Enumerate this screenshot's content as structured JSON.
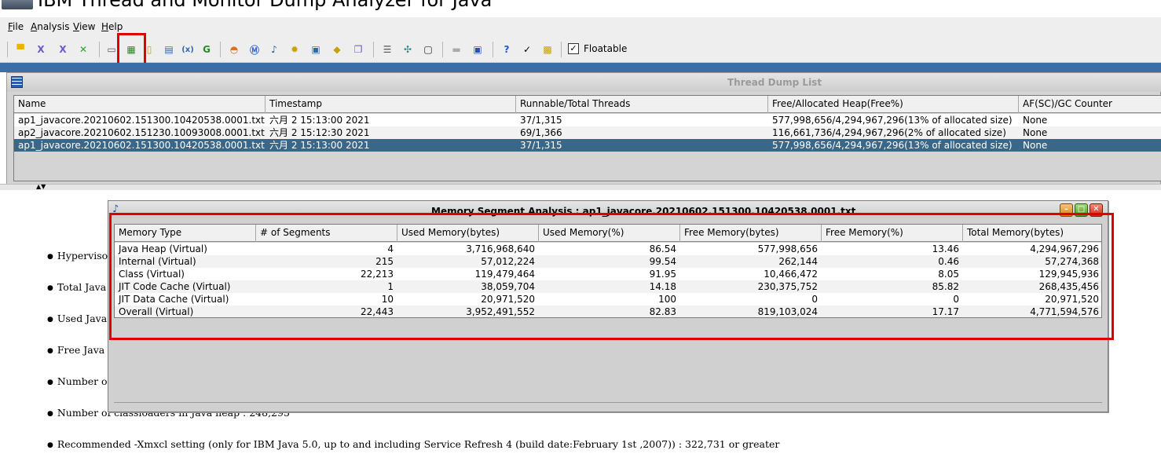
{
  "window": {
    "title": "IBM Thread and Monitor Dump Analyzer for Java"
  },
  "menu": [
    "File",
    "Analysis",
    "View",
    "Help"
  ],
  "toolbar": {
    "floatable_label": "Floatable",
    "floatable_checked": "✓",
    "icons": [
      "open-folder-icon",
      "close-icon",
      "close-all-icon",
      "clear-icon",
      "thread-dump-icon",
      "memory-segment-icon",
      "delete-icon",
      "compare-icon",
      "variables-icon",
      "refresh-icon",
      "monitor-chart-icon",
      "method-icon",
      "analyze-icon",
      "gear-icon",
      "thread-detail-icon",
      "gc-icon",
      "compare-monitors-icon",
      "list-icon",
      "expand-icon",
      "window-icon",
      "blank-icon",
      "display-icon",
      "help-icon",
      "check-icon",
      "about-icon"
    ]
  },
  "thread_dump_list": {
    "title": "Thread Dump List",
    "columns": [
      "Name",
      "Timestamp",
      "Runnable/Total Threads",
      "Free/Allocated Heap(Free%)",
      "AF(SC)/GC Counter"
    ],
    "rows": [
      [
        "ap1_javacore.20210602.151300.10420538.0001.txt",
        "六月 2 15:13:00 2021",
        "37/1,315",
        "577,998,656/4,294,967,296(13% of allocated size)",
        "None"
      ],
      [
        "ap2_javacore.20210602.151230.10093008.0001.txt",
        "六月 2 15:12:30 2021",
        "69/1,366",
        "116,661,736/4,294,967,296(2% of allocated size)",
        "None"
      ],
      [
        "ap1_javacore.20210602.151300.10420538.0001.txt",
        "六月 2 15:13:00 2021",
        "37/1,315",
        "577,998,656/4,294,967,296(13% of allocated size)",
        "None"
      ]
    ],
    "selected_row": 2
  },
  "report_bullets": [
    "Hypervisor",
    "Total Java",
    "Used Java",
    "Free Java h",
    "Number of",
    "Number of classloaders in Java heap : 248,295",
    "Recommended -Xmxcl setting (only for IBM Java 5.0, up to and including Service Refresh 4 (build date:February 1st ,2007)) : 322,731 or greater"
  ],
  "memory_segment_analysis": {
    "title": "Memory Segment Analysis : ap1_javacore.20210602.151300.10420538.0001.txt",
    "columns": [
      "Memory Type",
      "# of Segments",
      "Used Memory(bytes)",
      "Used Memory(%)",
      "Free Memory(bytes)",
      "Free Memory(%)",
      "Total Memory(bytes)"
    ],
    "rows": [
      [
        "Java Heap (Virtual)",
        "4",
        "3,716,968,640",
        "86.54",
        "577,998,656",
        "13.46",
        "4,294,967,296"
      ],
      [
        "Internal (Virtual)",
        "215",
        "57,012,224",
        "99.54",
        "262,144",
        "0.46",
        "57,274,368"
      ],
      [
        "Class (Virtual)",
        "22,213",
        "119,479,464",
        "91.95",
        "10,466,472",
        "8.05",
        "129,945,936"
      ],
      [
        "JIT Code Cache (Virtual)",
        "1",
        "38,059,704",
        "14.18",
        "230,375,752",
        "85.82",
        "268,435,456"
      ],
      [
        "JIT Data Cache (Virtual)",
        "10",
        "20,971,520",
        "100",
        "0",
        "0",
        "20,971,520"
      ],
      [
        "Overall (Virtual)",
        "22,443",
        "3,952,491,552",
        "82.83",
        "819,103,024",
        "17.17",
        "4,771,594,576"
      ]
    ]
  },
  "colors": {
    "selection": "#3a6688",
    "highlight": "#e00000",
    "desktop": "#3a6ea5"
  }
}
